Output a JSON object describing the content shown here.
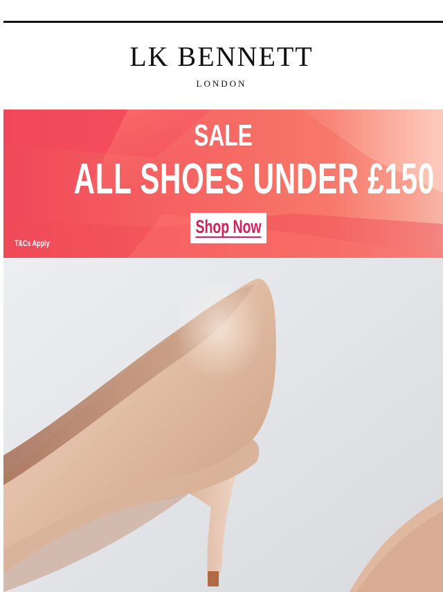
{
  "brand": {
    "name": "LK BENNETT",
    "subtitle": "LONDON"
  },
  "promo_banner": {
    "title": "SALE",
    "headline": "ALL SHOES UNDER £150",
    "cta_label": "Shop Now",
    "terms": "T&Cs Apply",
    "colors": {
      "background": "#f45b5f",
      "text": "#ffffff",
      "cta_text": "#d61f58"
    }
  },
  "product": {
    "image": "nude-patent-court-shoe"
  }
}
